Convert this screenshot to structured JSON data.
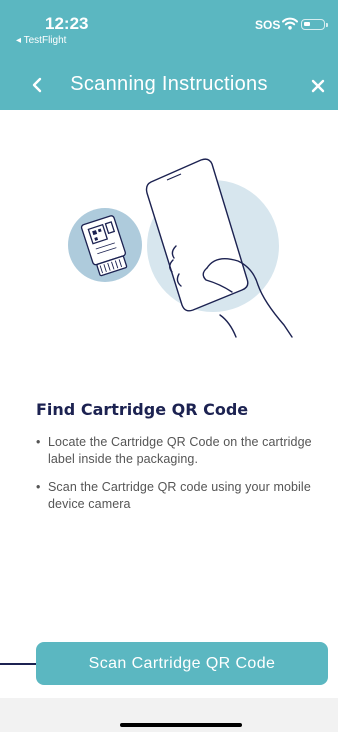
{
  "status_bar": {
    "time": "12:23",
    "back_app": "◂ TestFlight",
    "sos": "SOS"
  },
  "nav": {
    "title": "Scanning Instructions",
    "back_icon": "chevron-left-icon",
    "close_icon": "close-icon"
  },
  "illustration": {
    "icon": "phone-scanning-cartridge-illustration"
  },
  "content": {
    "title": "Find Cartridge QR Code",
    "bullets": [
      "Locate the Cartridge QR Code on the cartridge label inside the packaging.",
      "Scan the Cartridge QR code using your mobile device camera"
    ]
  },
  "actions": {
    "scan_button_label": "Scan Cartridge QR Code"
  },
  "colors": {
    "header": "#5bb7c1",
    "accent": "#5bb7c1",
    "title_text": "#1c2251"
  }
}
